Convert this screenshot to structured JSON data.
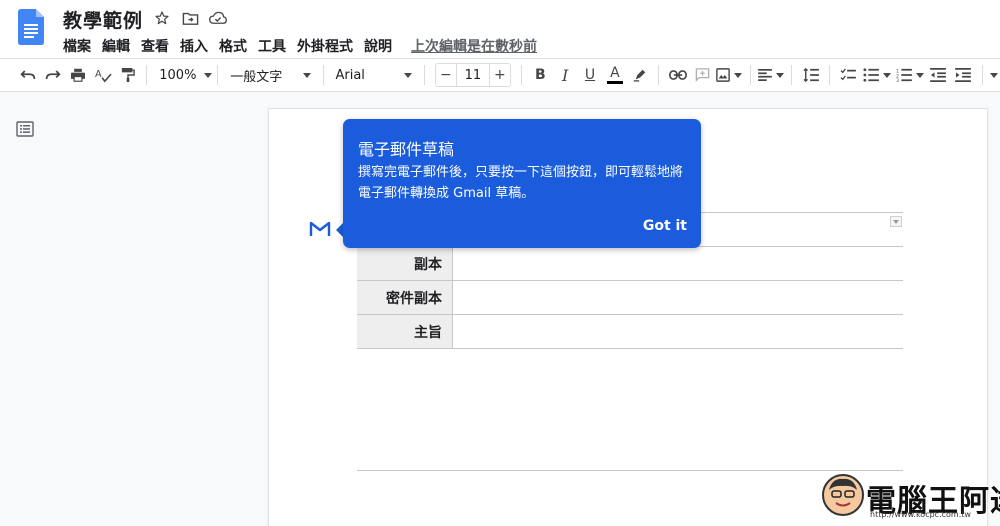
{
  "doc": {
    "title": "教學範例",
    "last_edit": "上次編輯是在數秒前"
  },
  "menu": [
    "檔案",
    "編輯",
    "查看",
    "插入",
    "格式",
    "工具",
    "外掛程式",
    "說明"
  ],
  "toolbar": {
    "zoom": "100%",
    "style": "一般文字",
    "font": "Arial",
    "font_size": "11",
    "minus": "−",
    "plus": "+",
    "bold": "B",
    "italic": "I",
    "underline": "U",
    "text_color_letter": "A"
  },
  "email_draft": {
    "rows": [
      {
        "label": "副本"
      },
      {
        "label": "密件副本"
      },
      {
        "label": "主旨"
      }
    ]
  },
  "tooltip": {
    "title": "電子郵件草稿",
    "body": "撰寫完電子郵件後，只要按一下這個按鈕，即可輕鬆地將電子郵件轉換成 Gmail 草稿。",
    "button": "Got it"
  },
  "watermark": {
    "text": "電腦王阿達",
    "url": "http://www.kocpc.com.tw"
  },
  "colors": {
    "accent": "#1a5cdb",
    "docs_blue": "#4285f4"
  }
}
